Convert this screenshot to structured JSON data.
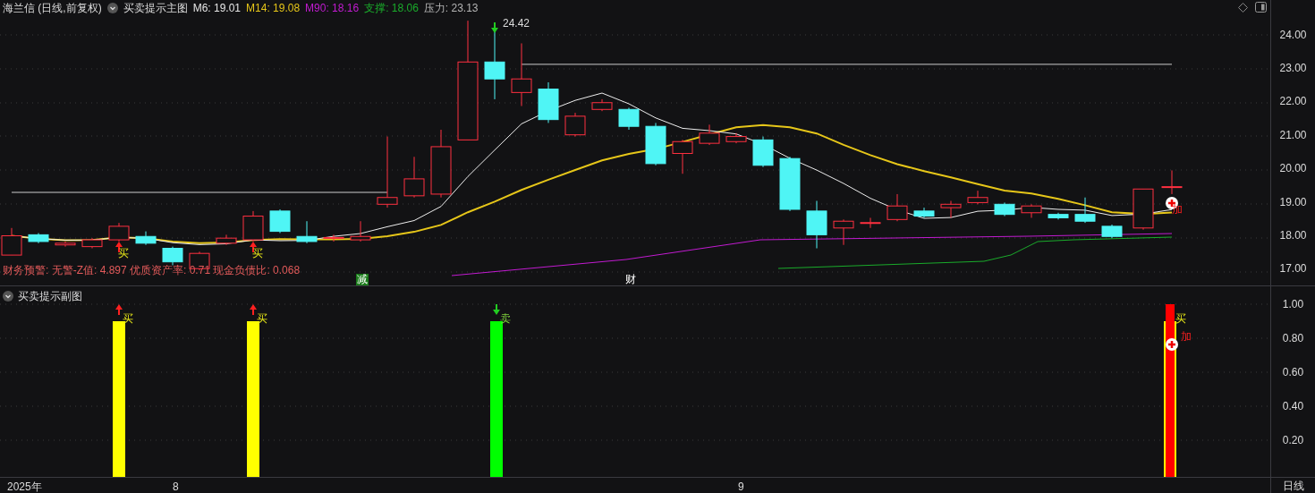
{
  "header": {
    "stock": "海兰信 (日线,前复权)",
    "indicator_name": "买卖提示主图",
    "values": [
      {
        "label": "M6: 19.01",
        "color": "#e6e6e6"
      },
      {
        "label": "M14: 19.08",
        "color": "#e6c619"
      },
      {
        "label": "M90: 18.16",
        "color": "#c21bd1"
      },
      {
        "label": "支撑: 18.06",
        "color": "#1aab2b"
      },
      {
        "label": "压力: 23.13",
        "color": "#b4b4b4"
      }
    ]
  },
  "main_chart": {
    "high_label": "24.42",
    "finance_warning": "财务预警: 无警-Z值: 4.897 优质资产率: 0.71 现金负债比: 0.068",
    "price_axis": [
      "24.00",
      "23.00",
      "22.00",
      "21.00",
      "20.00",
      "19.00",
      "18.00",
      "17.00"
    ],
    "signals": [
      {
        "kind": "buy",
        "text": "买"
      },
      {
        "kind": "buy",
        "text": "买"
      },
      {
        "kind": "add",
        "text": "加"
      }
    ],
    "events": [
      {
        "kind": "reduce",
        "text": "减"
      },
      {
        "kind": "finance",
        "text": "财"
      }
    ]
  },
  "sub_chart": {
    "title": "买卖提示副图",
    "axis": [
      "1.00",
      "0.80",
      "0.60",
      "0.40",
      "0.20"
    ],
    "signals": [
      {
        "kind": "buy",
        "text": "买"
      },
      {
        "kind": "buy",
        "text": "买"
      },
      {
        "kind": "sell",
        "text": "卖"
      },
      {
        "kind": "buy",
        "text": "买"
      },
      {
        "kind": "add",
        "text": "加"
      }
    ]
  },
  "time_axis": {
    "labels": [
      "2025年",
      "8",
      "9"
    ],
    "period": "日线"
  }
}
